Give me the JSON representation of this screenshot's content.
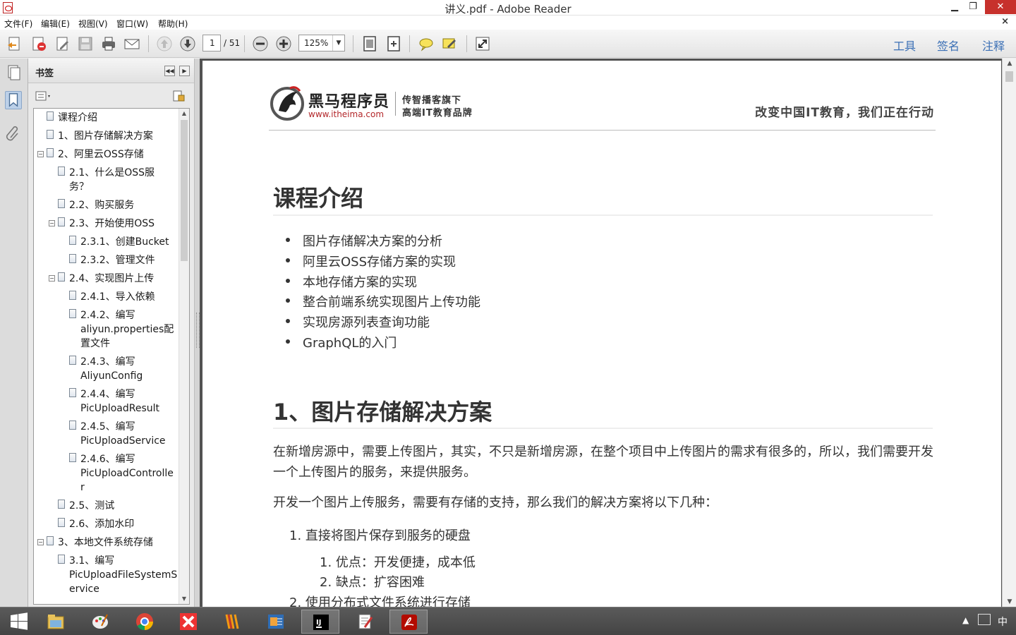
{
  "window": {
    "title": "讲义.pdf - Adobe Reader",
    "min": "▁",
    "max": "❐",
    "close": "✕"
  },
  "menu": {
    "items": [
      "文件(F)",
      "编辑(E)",
      "视图(V)",
      "窗口(W)",
      "帮助(H)"
    ],
    "close": "×"
  },
  "toolbar": {
    "page_current": "1",
    "page_total": "/ 51",
    "zoom": "125%",
    "zoom_arrow": "▼",
    "tools_label": "工具",
    "sign_label": "签名",
    "comment_label": "注释",
    "icons": [
      "create-pdf-icon",
      "export-pdf-icon",
      "edit-icon",
      "save-icon",
      "print-icon",
      "email-icon",
      "previous-page-icon",
      "next-page-icon",
      "zoom-out-icon",
      "zoom-in-icon",
      "fit-page-icon",
      "fit-width-icon",
      "comment-icon",
      "highlight-icon",
      "full-screen-icon"
    ]
  },
  "bookmarks": {
    "title": "书签",
    "collapse": "◀◀",
    "expand": "▶",
    "items": [
      {
        "label": "课程介绍",
        "level": 0,
        "toggle": ""
      },
      {
        "label": "1、图片存储解决方案",
        "level": 0,
        "toggle": ""
      },
      {
        "label": "2、阿里云OSS存储",
        "level": 0,
        "toggle": "−"
      },
      {
        "label": "2.1、什么是OSS服",
        "label2": "务？",
        "level": 1,
        "toggle": ""
      },
      {
        "label": "2.2、购买服务",
        "level": 1,
        "toggle": ""
      },
      {
        "label": "2.3、开始使用OSS",
        "level": 1,
        "toggle": "−"
      },
      {
        "label": "2.3.1、创建Bucket",
        "level": 2,
        "toggle": ""
      },
      {
        "label": "2.3.2、管理文件",
        "level": 2,
        "toggle": ""
      },
      {
        "label": "2.4、实现图片上传",
        "level": 1,
        "toggle": "−"
      },
      {
        "label": "2.4.1、导入依赖",
        "level": 2,
        "toggle": ""
      },
      {
        "label": "2.4.2、编写",
        "label2": "aliyun.properties配",
        "label3": "置文件",
        "level": 2,
        "toggle": ""
      },
      {
        "label": "2.4.3、编写",
        "label2": "AliyunConfig",
        "level": 2,
        "toggle": ""
      },
      {
        "label": "2.4.4、编写",
        "label2": "PicUploadResult",
        "level": 2,
        "toggle": ""
      },
      {
        "label": "2.4.5、编写",
        "label2": "PicUploadService",
        "level": 2,
        "toggle": ""
      },
      {
        "label": "2.4.6、编写",
        "label2": "PicUploadControlle",
        "label3": "r",
        "level": 2,
        "toggle": ""
      },
      {
        "label": "2.5、测试",
        "level": 1,
        "toggle": ""
      },
      {
        "label": "2.6、添加水印",
        "level": 1,
        "toggle": ""
      },
      {
        "label": "3、本地文件系统存储",
        "level": 0,
        "toggle": "−"
      },
      {
        "label": "3.1、编写",
        "label2": "PicUploadFileSystemS",
        "label3": "ervice",
        "level": 1,
        "toggle": ""
      }
    ]
  },
  "document": {
    "logo_cn": "黑马程序员",
    "logo_url": "www.itheima.com",
    "logo_tag1": "传智播客旗下",
    "logo_tag2": "高端IT教育品牌",
    "slogan": "改变中国IT教育，我们正在行动",
    "section1_title": "课程介绍",
    "bullets": [
      "图片存储解决方案的分析",
      "阿里云OSS存储方案的实现",
      "本地存储方案的实现",
      "整合前端系统实现图片上传功能",
      "实现房源列表查询功能",
      "GraphQL的入门"
    ],
    "section2_title": "1、图片存储解决方案",
    "para1": "在新增房源中，需要上传图片，其实，不只是新增房源，在整个项目中上传图片的需求有很多的，所以，我们需要开发一个上传图片的服务，来提供服务。",
    "para2": "开发一个图片上传服务，需要有存储的支持，那么我们的解决方案将以下几种：",
    "ol_1": "1. 直接将图片保存到服务的硬盘",
    "ol_1_1": "1. 优点：开发便捷，成本低",
    "ol_1_2": "2. 缺点：扩容困难",
    "ol_2": "2. 使用分布式文件系统进行存储"
  },
  "taskbar": {
    "apps": [
      "windows-start-icon",
      "file-explorer-icon",
      "paint-icon",
      "chrome-icon",
      "xmind-icon",
      "sublime-icon",
      "outlook-icon",
      "intellij-icon",
      "notepad-icon",
      "adobe-reader-icon"
    ],
    "ime": "中"
  },
  "colors": {
    "accent": "#3a6fb5",
    "close": "#c7312c",
    "brand_red": "#b3272a"
  }
}
